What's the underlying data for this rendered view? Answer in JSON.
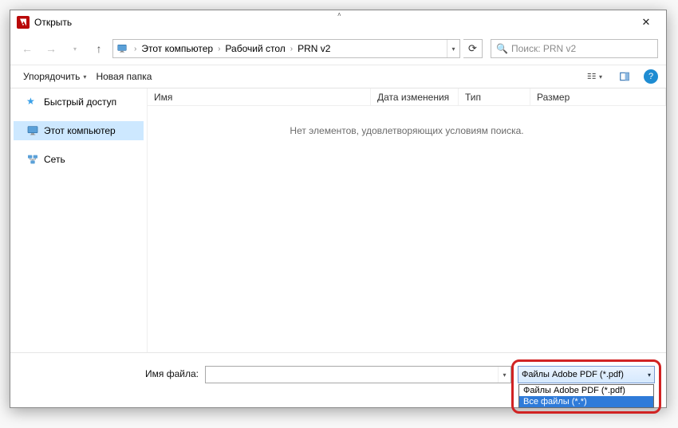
{
  "title": "Открыть",
  "breadcrumb": {
    "items": [
      "Этот компьютер",
      "Рабочий стол",
      "PRN v2"
    ]
  },
  "search": {
    "placeholder": "Поиск: PRN v2"
  },
  "toolbar": {
    "organize": "Упорядочить",
    "new_folder": "Новая папка"
  },
  "sidebar": {
    "items": [
      {
        "label": "Быстрый доступ"
      },
      {
        "label": "Этот компьютер"
      },
      {
        "label": "Сеть"
      }
    ]
  },
  "columns": {
    "name": "Имя",
    "date": "Дата изменения",
    "type": "Тип",
    "size": "Размер"
  },
  "empty_message": "Нет элементов, удовлетворяющих условиям поиска.",
  "filename_label": "Имя файла:",
  "filename_value": "",
  "filter": {
    "selected": "Файлы Adobe PDF (*.pdf)",
    "options": [
      "Файлы Adobe PDF (*.pdf)",
      "Все файлы (*.*)"
    ]
  }
}
